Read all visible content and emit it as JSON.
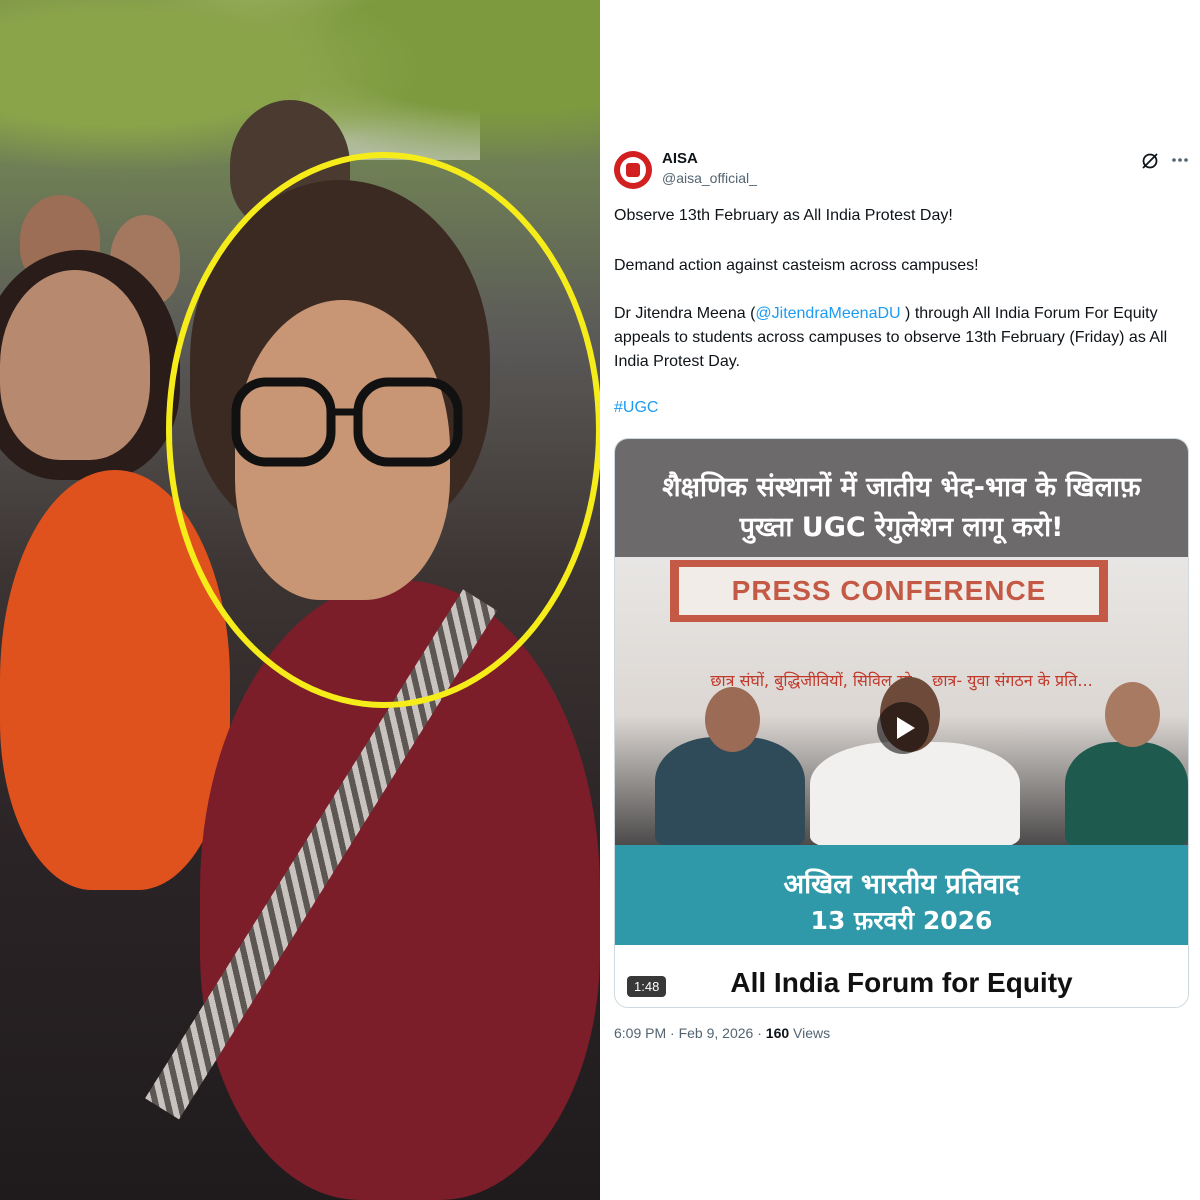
{
  "tweet": {
    "display_name": "AISA",
    "handle": "@aisa_official_",
    "line1": "Observe 13th February as All India Protest Day!",
    "line2": "Demand action against casteism across campuses!",
    "line3_pre": "Dr Jitendra Meena (",
    "line3_mention": "@JitendraMeenaDU",
    "line3_post": " ) through All India Forum For Equity appeals to students across campuses to observe 13th February (Friday) as All India Protest Day.",
    "hashtag": "#UGC",
    "time": "6:09 PM",
    "separator": " · ",
    "date": "Feb 9, 2026",
    "views_count": "160",
    "views_label": "Views"
  },
  "media": {
    "headline_line1": "शैक्षणिक संस्थानों में जातीय भेद-भाव के खिलाफ़",
    "headline_line2": "पुख्ता UGC रेगुलेशन लागू करो!",
    "banner": "PRESS CONFERENCE",
    "backdrop_text": "छात्र संघों, बुद्धिजीवियों, सिविल सो...    छात्र- युवा संगठन के प्रति...",
    "protest_line1": "अखिल भारतीय प्रतिवाद",
    "protest_line2": "13 फ़रवरी 2026",
    "forum_title": "All India Forum for Equity",
    "duration": "1:48"
  },
  "icons": {
    "avatar": "aisa-logo-icon",
    "grok": "grok-icon",
    "more": "more-options-icon",
    "play": "play-icon"
  },
  "colors": {
    "highlight_circle": "#f6ec1a",
    "link": "#1d9bf0",
    "avatar_red": "#d21f1f",
    "teal_band": "#2f99aa"
  }
}
